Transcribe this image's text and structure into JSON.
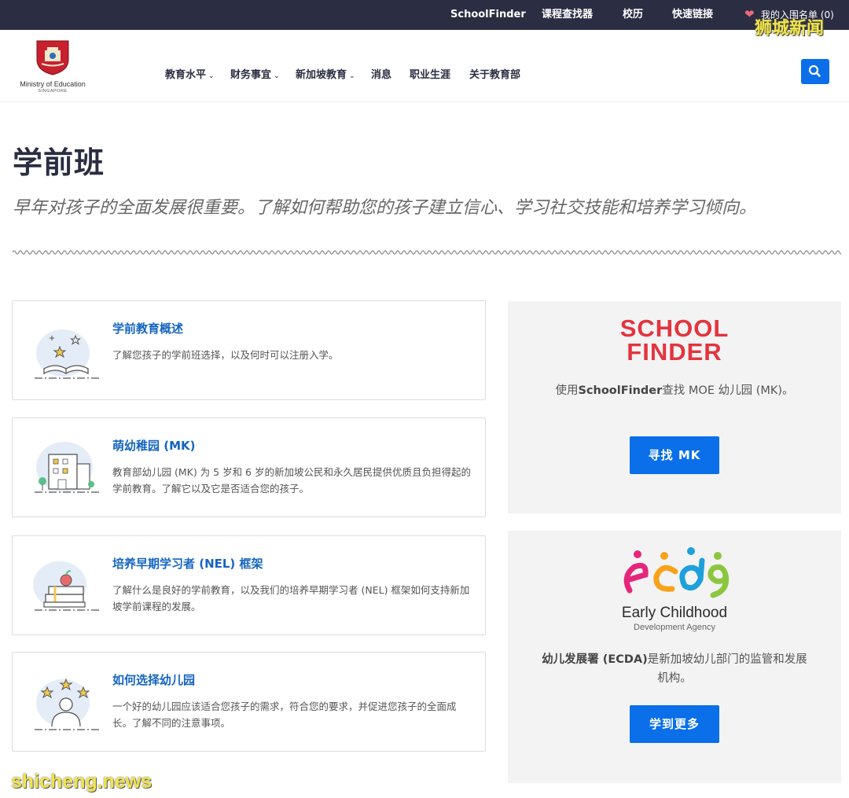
{
  "topbar": {
    "links": [
      "SchoolFinder",
      "课程查找器",
      "校历",
      "快速链接"
    ],
    "favorites": "我的入围名单 (0)"
  },
  "header": {
    "org_name": "Ministry of Education",
    "org_sub": "SINGAPORE",
    "nav": [
      {
        "label": "教育水平",
        "has_dropdown": true
      },
      {
        "label": "财务事宜",
        "has_dropdown": true
      },
      {
        "label": "新加坡教育",
        "has_dropdown": true
      },
      {
        "label": "消息",
        "has_dropdown": false
      },
      {
        "label": "职业生涯",
        "has_dropdown": false
      },
      {
        "label": "关于教育部",
        "has_dropdown": false
      }
    ]
  },
  "page": {
    "title": "学前班",
    "lead": "早年对孩子的全面发展很重要。了解如何帮助您的孩子建立信心、学习社交技能和培养学习倾向。"
  },
  "cards": [
    {
      "title": "学前教育概述",
      "desc": "了解您孩子的学前班选择，以及何时可以注册入学。",
      "icon": "open-book-stars-icon"
    },
    {
      "title": "萌幼稚园 (MK)",
      "desc": "教育部幼儿园 (MK) 为 5 岁和 6 岁的新加坡公民和永久居民提供优质且负担得起的学前教育。了解它以及它是否适合您的孩子。",
      "icon": "school-building-icon"
    },
    {
      "title": "培养早期学习者 (NEL) 框架",
      "desc": "了解什么是良好的学前教育，以及我们的培养早期学习者 (NEL) 框架如何支持新加坡学前课程的发展。",
      "icon": "books-apple-icon"
    },
    {
      "title": "如何选择幼儿园",
      "desc": "一个好的幼儿园应该适合您孩子的需求，符合您的要求，并促进您孩子的全面成长。了解不同的注意事项。",
      "icon": "child-stars-icon"
    }
  ],
  "schoolfinder_panel": {
    "logo_line1": "SCHOOL",
    "logo_line2": "FINDER",
    "text_bold": "SchoolFinder",
    "text_pre": "使用",
    "text_post": "查找 MOE 幼儿园 (MK)。",
    "button": "寻找 MK"
  },
  "ecda_panel": {
    "logo_name": "Early Childhood",
    "logo_sub": "Development Agency",
    "text_bold": "幼儿发展署 (ECDA)",
    "text_post": "是新加坡幼儿部门的监管和发展机构。",
    "button": "学到更多"
  },
  "watermarks": {
    "top": "狮城新闻",
    "bottom": "shicheng.news"
  },
  "colors": {
    "topbar_bg": "#2b2d42",
    "accent_blue": "#0a6fe8",
    "card_title": "#1565c0",
    "panel_bg": "#f3f3f4",
    "schoolfinder_red": "#e3343e"
  }
}
